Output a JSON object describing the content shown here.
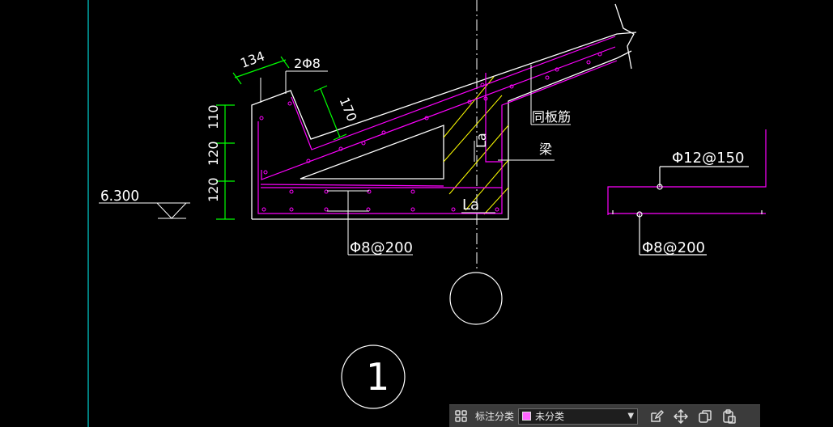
{
  "drawing": {
    "elevation": "6.300",
    "dim_top": "134",
    "rebar_top": "2Φ8",
    "dim_slope": "170",
    "dim_vertical": [
      "110",
      "120",
      "120"
    ],
    "label_same_slab": "同板筋",
    "label_beam": "梁",
    "la_vertical": "La",
    "la_horizontal": "La",
    "rebar_bottom": "Φ8@200",
    "detail_top_rebar": "Φ12@150",
    "detail_bottom_rebar": "Φ8@200",
    "section_number": "1",
    "colors": {
      "outline": "#ffffff",
      "rebar": "#ff00ff",
      "dimension": "#00ff00",
      "hatch": "#ffff00",
      "guide": "#00ffff"
    }
  },
  "toolbar": {
    "category_label": "标注分类",
    "category_value": "未分类",
    "swatch_color": "#ff66ff",
    "icons": [
      "grid-icon",
      "edit-icon",
      "move-icon",
      "copy-icon",
      "paste-icon"
    ]
  }
}
